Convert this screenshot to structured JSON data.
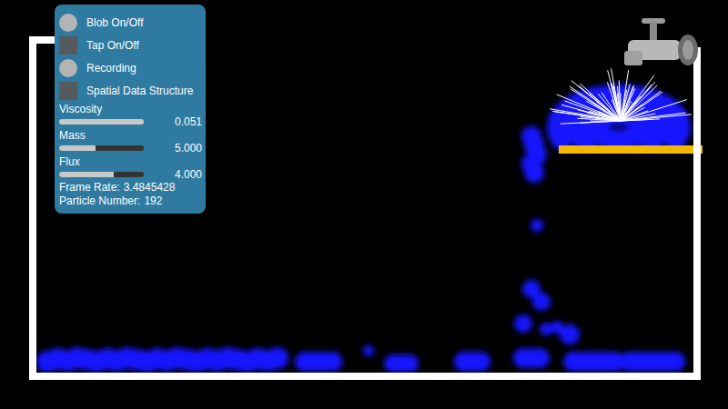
{
  "panel": {
    "toggles": [
      {
        "label": "Blob On/Off",
        "kind": "round",
        "on": true
      },
      {
        "label": "Tap On/Off",
        "kind": "square",
        "on": false
      },
      {
        "label": "Recording",
        "kind": "round",
        "on": true
      },
      {
        "label": "Spatial Data Structure",
        "kind": "square",
        "on": false
      }
    ],
    "sliders": [
      {
        "label": "Viscosity",
        "level": 1.0,
        "reading": "0.051"
      },
      {
        "label": "Mass",
        "level": 0.43,
        "reading": "5.000"
      },
      {
        "label": "Flux",
        "level": 0.65,
        "reading": "4.000"
      }
    ],
    "stats": [
      {
        "label": "Frame Rate:",
        "value": "3.4845428"
      },
      {
        "label": "Particle Number:",
        "value": "192"
      }
    ]
  }
}
